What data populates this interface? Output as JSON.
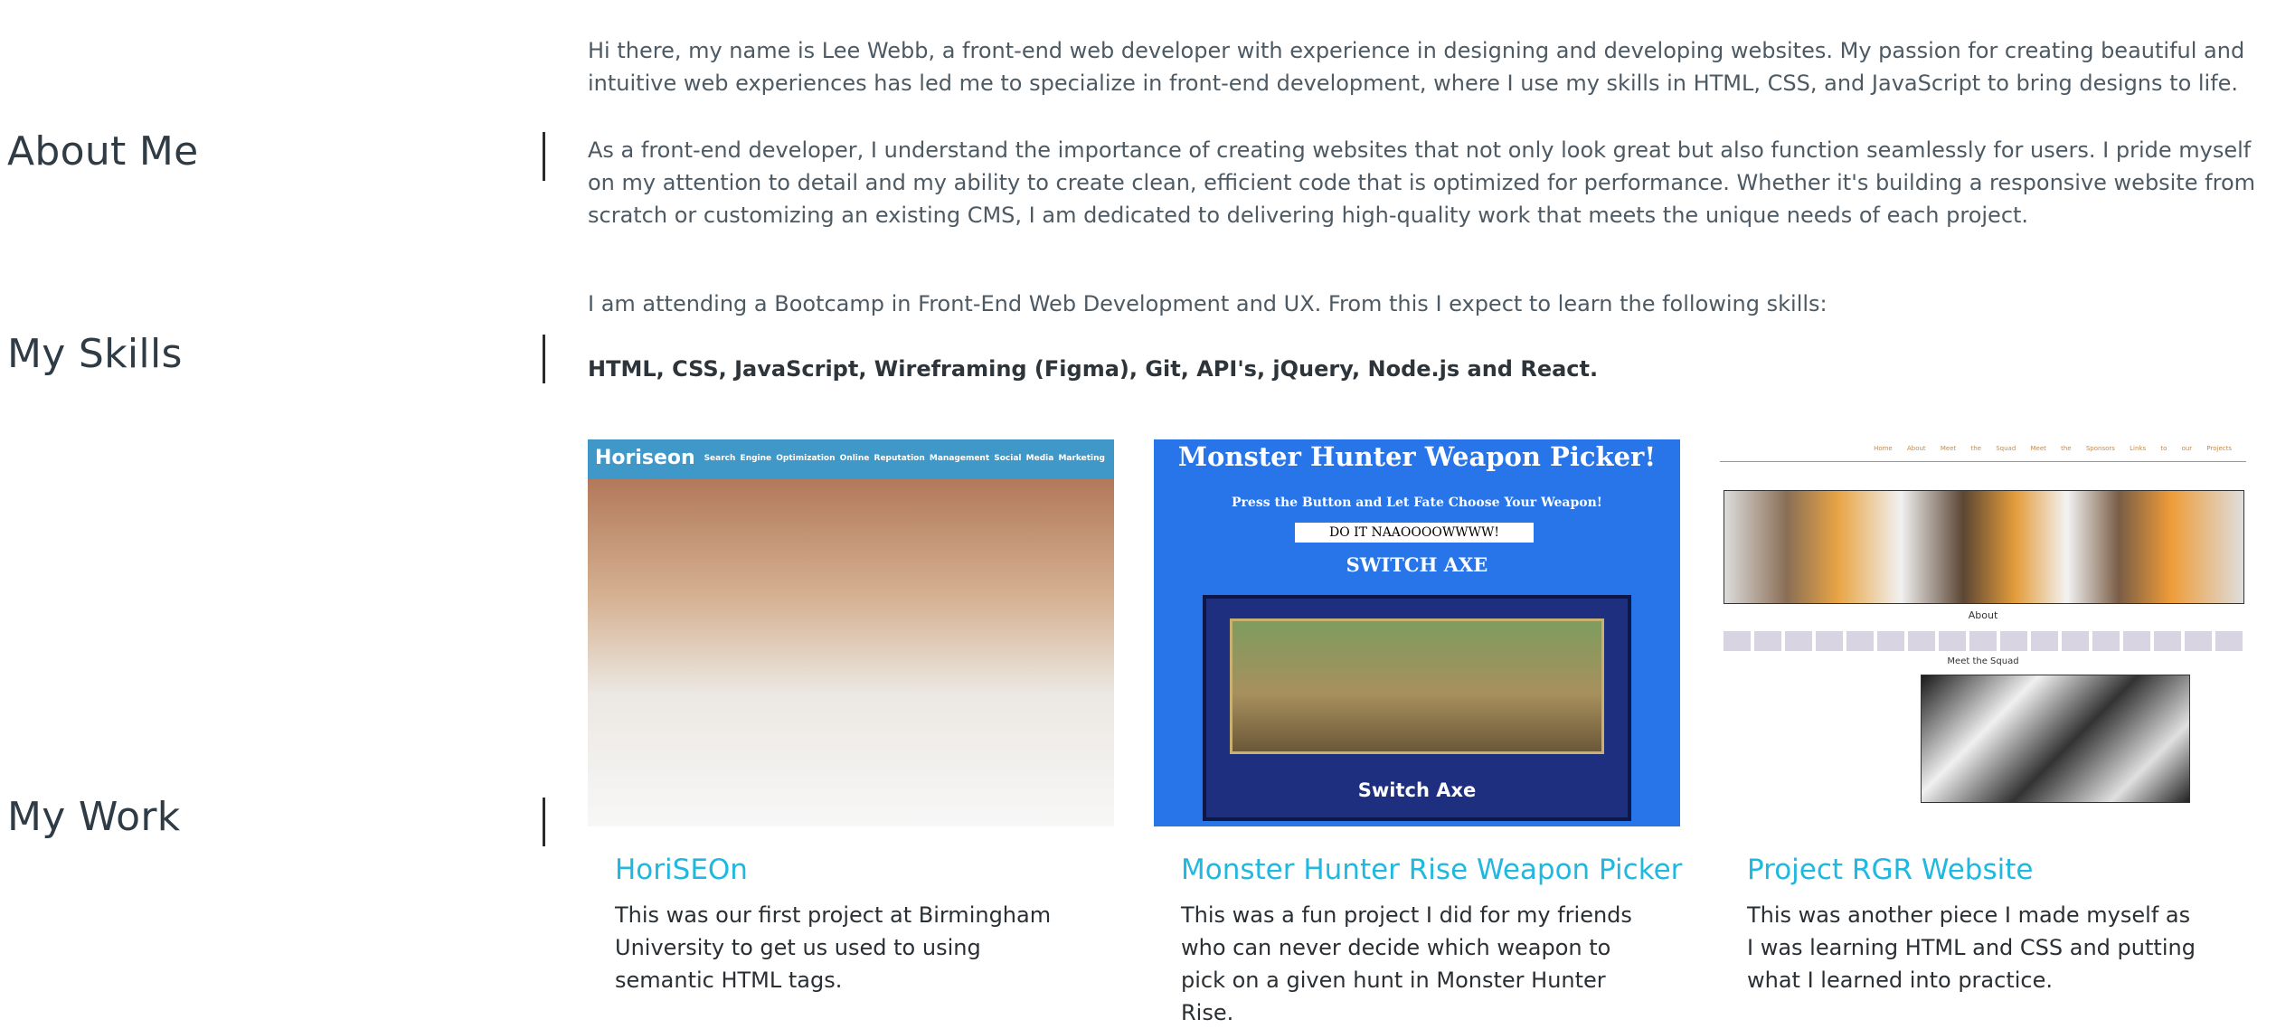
{
  "about": {
    "heading": "About Me",
    "para1": "Hi there, my name is Lee Webb, a front-end web developer with experience in designing and developing websites. My passion for creating beautiful and intuitive web experiences has led me to specialize in front-end development, where I use my skills in HTML, CSS, and JavaScript to bring designs to life.",
    "para2": "As a front-end developer, I understand the importance of creating websites that not only look great but also function seamlessly for users. I pride myself on my attention to detail and my ability to create clean, efficient code that is optimized for performance. Whether it's building a responsive website from scratch or customizing an existing CMS, I am dedicated to delivering high-quality work that meets the unique needs of each project."
  },
  "skills": {
    "heading": "My Skills",
    "intro": "I am attending a Bootcamp in Front-End Web Development and UX. From this I expect to learn the following skills:",
    "list": "HTML, CSS, JavaScript, Wireframing (Figma), Git, API's, jQuery, Node.js and React."
  },
  "work": {
    "heading": "My Work",
    "projects": [
      {
        "title": "HoriSEOn",
        "description": "This was our first project at Birmingham University to get us used to using semantic HTML tags.",
        "thumb_logo": "Horiseon",
        "thumb_nav": "Search Engine Optimization   Online Reputation Management   Social Media Marketing"
      },
      {
        "title": "Monster Hunter Rise Weapon Picker",
        "description": "This was a fun project I did for my friends who can never decide which weapon to pick on a given hunt in Monster Hunter Rise.",
        "thumb_heading": "Monster Hunter Weapon Picker!",
        "thumb_sub": "Press the Button and Let Fate Choose Your Weapon!",
        "thumb_button": "DO IT NAAOOOOWWWW!",
        "thumb_weapon": "SWITCH AXE",
        "thumb_label": "Switch Axe"
      },
      {
        "title": "Project RGR Website",
        "description": "This was another piece I made myself as I was learning HTML and CSS and putting what I learned into practice.",
        "thumb_nav": "Home About Meet the Squad Meet the Sponsors Links to our Projects",
        "thumb_about": "About",
        "thumb_squad": "Meet the Squad"
      }
    ]
  },
  "colors": {
    "heading": "#2f3b45",
    "body_text": "#4d5a63",
    "link": "#1fb8e0",
    "divider": "#2b2b2b"
  }
}
